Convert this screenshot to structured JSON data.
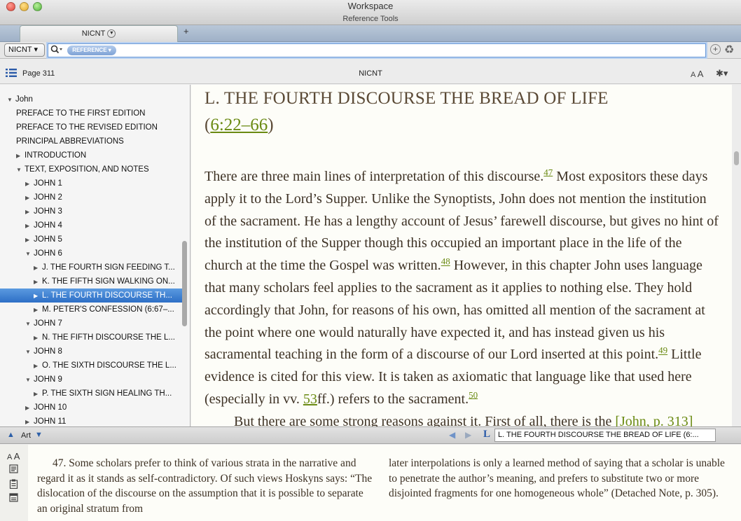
{
  "window": {
    "title": "Workspace",
    "subtitle": "Reference Tools"
  },
  "tabs": [
    {
      "label": "NICNT",
      "dropdown_icon": "chevron-down-icon"
    }
  ],
  "new_tab": "+",
  "search": {
    "resource_select": "NICNT ▾",
    "query": "",
    "mode_pill": "REFERENCE ▾"
  },
  "pane_header": {
    "page": "Page 311",
    "resource": "NICNT",
    "font_size_small": "A",
    "font_size_large": "A",
    "gear": "✱▾"
  },
  "toc": {
    "items": [
      {
        "label": "John",
        "expanded": true,
        "indent": 0
      },
      {
        "label": "PREFACE TO THE FIRST EDITION",
        "indent": 1,
        "leaf": true
      },
      {
        "label": "PREFACE TO THE REVISED EDITION",
        "indent": 1,
        "leaf": true
      },
      {
        "label": "PRINCIPAL ABBREVIATIONS",
        "indent": 1,
        "leaf": true
      },
      {
        "label": "INTRODUCTION",
        "indent": 1,
        "expanded": false
      },
      {
        "label": "TEXT, EXPOSITION, AND NOTES",
        "indent": 1,
        "expanded": true
      },
      {
        "label": "JOHN 1",
        "indent": 2,
        "expanded": false
      },
      {
        "label": "JOHN 2",
        "indent": 2,
        "expanded": false
      },
      {
        "label": "JOHN 3",
        "indent": 2,
        "expanded": false
      },
      {
        "label": "JOHN 4",
        "indent": 2,
        "expanded": false
      },
      {
        "label": "JOHN 5",
        "indent": 2,
        "expanded": false
      },
      {
        "label": "JOHN 6",
        "indent": 2,
        "expanded": true
      },
      {
        "label": "J. THE FOURTH SIGN FEEDING T...",
        "indent": 3,
        "expanded": false
      },
      {
        "label": "K. THE FIFTH SIGN WALKING ON...",
        "indent": 3,
        "expanded": false
      },
      {
        "label": "L. THE FOURTH DISCOURSE TH...",
        "indent": 3,
        "expanded": false,
        "selected": true
      },
      {
        "label": "M. PETER'S CONFESSION (6:67–...",
        "indent": 3,
        "expanded": false
      },
      {
        "label": "JOHN 7",
        "indent": 2,
        "expanded": true
      },
      {
        "label": "N. THE FIFTH DISCOURSE THE L...",
        "indent": 3,
        "expanded": false
      },
      {
        "label": "JOHN 8",
        "indent": 2,
        "expanded": true
      },
      {
        "label": "O. THE SIXTH DISCOURSE THE L...",
        "indent": 3,
        "expanded": false
      },
      {
        "label": "JOHN 9",
        "indent": 2,
        "expanded": true
      },
      {
        "label": "P. THE SIXTH SIGN HEALING TH...",
        "indent": 3,
        "expanded": false
      },
      {
        "label": "JOHN 10",
        "indent": 2,
        "expanded": false
      },
      {
        "label": "JOHN 11",
        "indent": 2,
        "expanded": false
      }
    ]
  },
  "reader": {
    "title": "L. THE FOURTH DISCOURSE THE BREAD OF LIFE",
    "title_ref_open": "(",
    "title_ref": "6:22–66",
    "title_ref_close": ")",
    "p1_a": "There are three main lines of interpretation of this discourse.",
    "fn47": "47",
    "p1_b": " Most expositors these days apply it to the Lord’s Supper. Unlike the Synoptists, John does not mention the institution of the sacrament. He has a lengthy account of Jesus’ farewell discourse, but gives no hint of the institution of the Supper though this occupied an important place in the life of the church at the time the Gospel was written.",
    "fn48": "48",
    "p1_c": " However, in this chapter John uses language that many scholars feel applies to the sacrament as it applies to nothing else. They hold accordingly that John, for reasons of his own, has omitted all mention of the sacrament at the point where one would naturally have expected it, and has instead given us his sacramental teaching in the form of a discourse of our Lord inserted at this point.",
    "fn49": "49",
    "p1_d": " Little evidence is cited for this view. It is taken as axiomatic that language like that used here (especially in vv. ",
    "vv_link": "53",
    "p1_e": "ff.) refers to the sacrament.",
    "fn50": "50",
    "p2_a": "But there are some strong reasons against it. First of all, there is the ",
    "p2_link": "[John, p. 313]"
  },
  "bottom_bar": {
    "art_label": "Art",
    "section_field": "L. THE FOURTH DISCOURSE THE BREAD OF LIFE (6:..."
  },
  "notes": {
    "font_small": "A",
    "font_large": "A",
    "col1": "47. Some scholars prefer to think of various strata in the narrative and regard it as it stands as self-contradictory. Of such views Hoskyns says: “The dislocation of the discourse on the assumption that it is possible to separate an original stratum from",
    "col2": "later interpolations is only a learned method of saying that a scholar is unable to penetrate the author’s meaning, and prefers to substitute two or more disjointed fragments for one homogeneous whole” (Detached Note, p. 305)."
  },
  "colors": {
    "accent": "#2d6fc6",
    "link_green": "#6a8a12",
    "title_brown": "#5b4a36",
    "body_text": "#3d3124"
  }
}
